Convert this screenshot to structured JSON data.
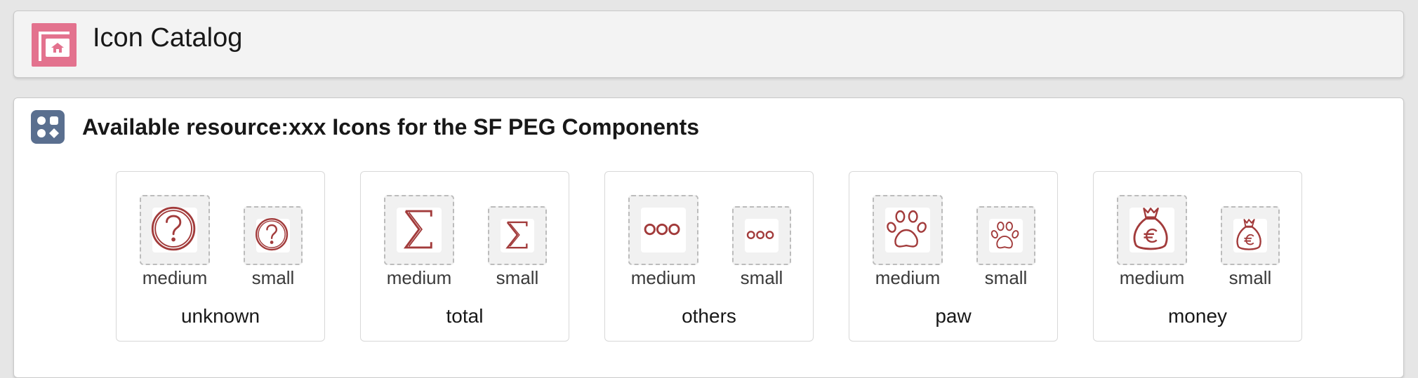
{
  "header": {
    "title": "Icon Catalog",
    "app_icon": "catalog-icon",
    "app_icon_color": "#e3728e"
  },
  "card": {
    "title": "Available resource:xxx Icons for the SF PEG Components",
    "icon": "apps-icon",
    "icon_color": "#5a6f8f"
  },
  "icon_color": "#a23b3b",
  "tiles": [
    {
      "name": "unknown",
      "icon": "question-icon",
      "medium_label": "medium",
      "small_label": "small"
    },
    {
      "name": "total",
      "icon": "sigma-icon",
      "medium_label": "medium",
      "small_label": "small"
    },
    {
      "name": "others",
      "icon": "ellipsis-icon",
      "medium_label": "medium",
      "small_label": "small"
    },
    {
      "name": "paw",
      "icon": "paw-icon",
      "medium_label": "medium",
      "small_label": "small"
    },
    {
      "name": "money",
      "icon": "money-bag-icon",
      "medium_label": "medium",
      "small_label": "small"
    }
  ]
}
